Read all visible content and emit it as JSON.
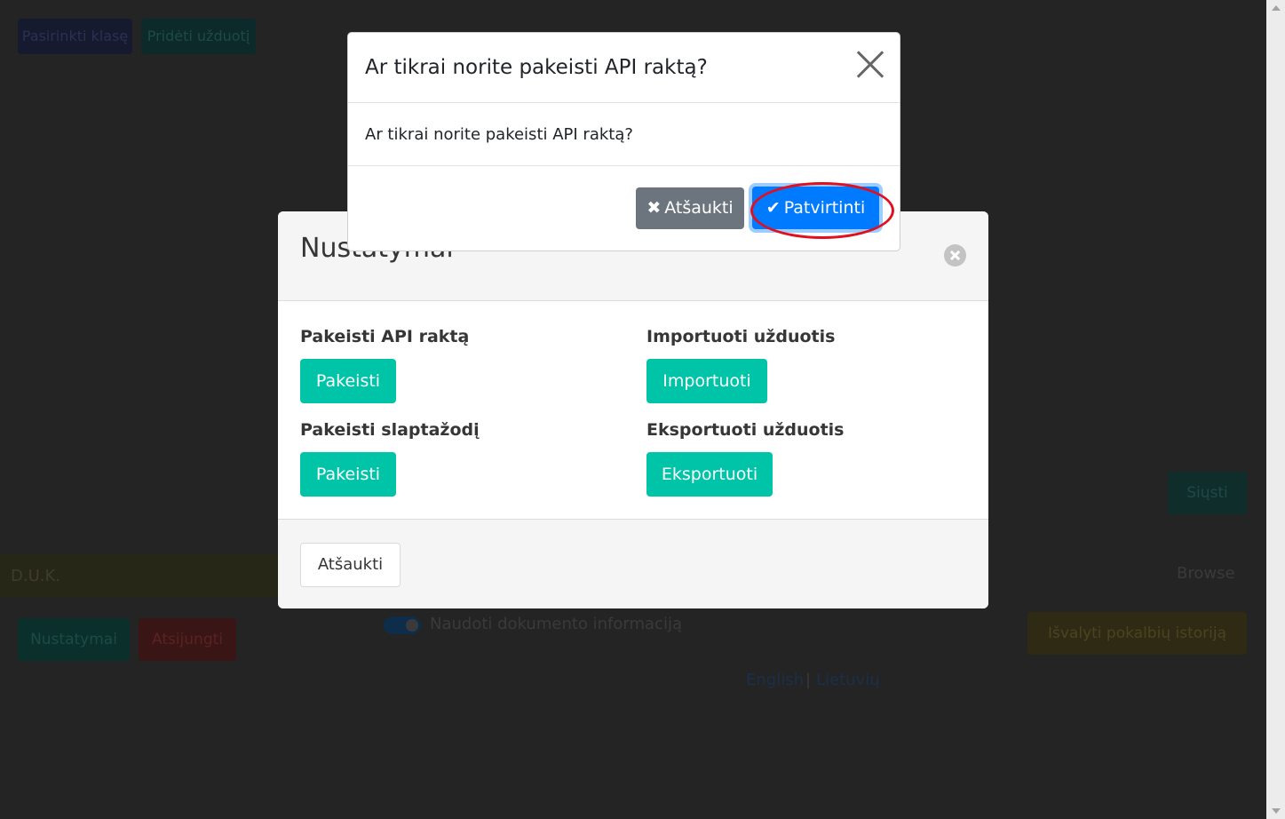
{
  "background": {
    "top_buttons": [
      "Pasirinkti klasę",
      "Pridėti užduotį"
    ],
    "faq_label": "D.U.K.",
    "left_buttons": [
      "Nustatymai",
      "Atsijungti"
    ],
    "send_button": "Siųsti",
    "browse_label": "Browse",
    "toggle_label": "Naudoti dokumento informaciją",
    "clear_history_button": "Išvalyti pokalbių istoriją",
    "languages": [
      "English",
      "Lietuvių"
    ],
    "language_separator": "|"
  },
  "settings_modal": {
    "title": "Nustatymai",
    "sections": [
      {
        "label": "Pakeisti API raktą",
        "button": "Pakeisti"
      },
      {
        "label": "Importuoti užduotis",
        "button": "Importuoti"
      },
      {
        "label": "Pakeisti slaptažodį",
        "button": "Pakeisti"
      },
      {
        "label": "Eksportuoti užduotis",
        "button": "Eksportuoti"
      }
    ],
    "cancel_button": "Atšaukti"
  },
  "confirm_modal": {
    "title": "Ar tikrai norite pakeisti API raktą?",
    "body": "Ar tikrai norite pakeisti API raktą?",
    "cancel_button": "Atšaukti",
    "cancel_icon": "times-icon",
    "confirm_button": "Patvirtinti",
    "confirm_icon": "check-icon"
  },
  "colors": {
    "teal": "#00c4a7",
    "primary": "#007bff",
    "secondary": "#6c757d",
    "highlight": "#e0101e"
  }
}
